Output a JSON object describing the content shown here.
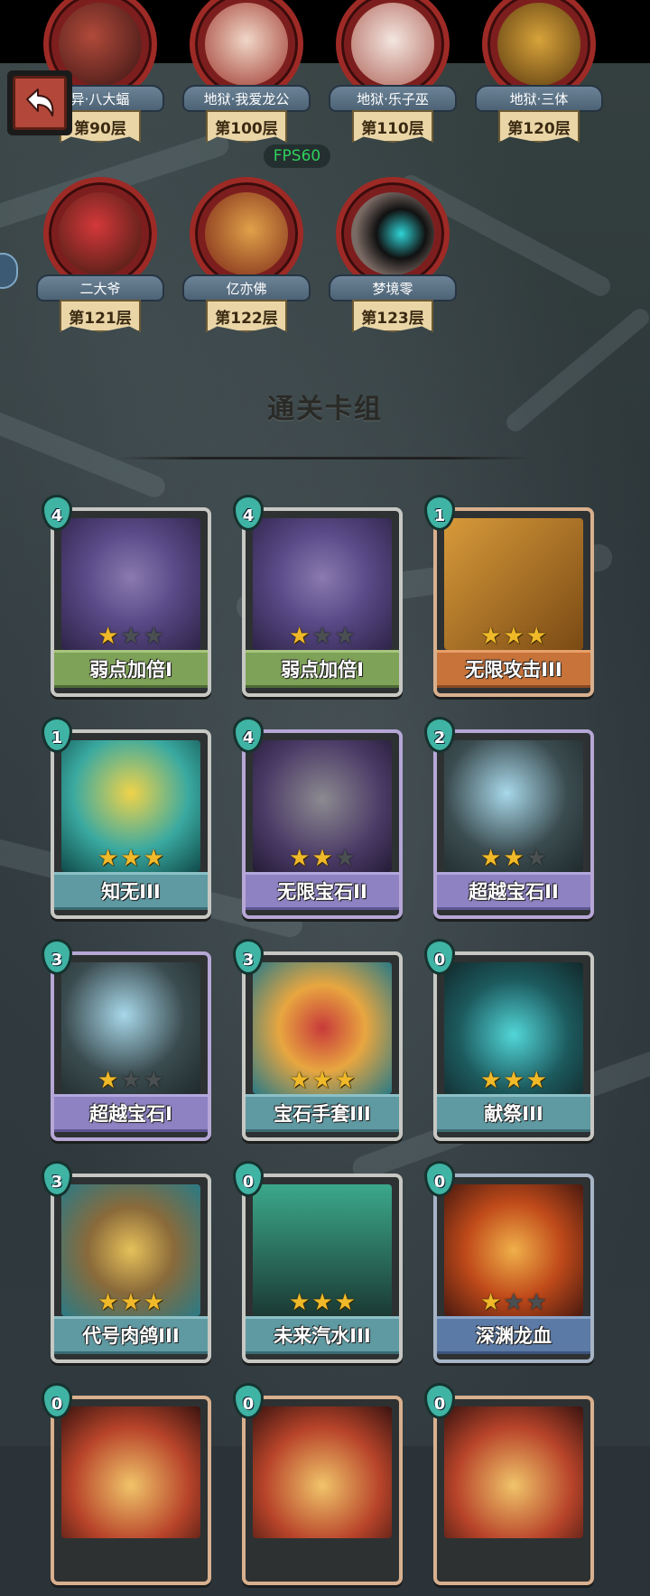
{
  "ui": {
    "back_icon": "back-arrow-icon",
    "fps_label": "FPS60",
    "section_title": "通关卡组"
  },
  "bosses_row1": [
    {
      "name": "异·八大蝠",
      "floor": "第90层"
    },
    {
      "name": "地狱·我爱龙公",
      "floor": "第100层"
    },
    {
      "name": "地狱·乐子巫",
      "floor": "第110层"
    },
    {
      "name": "地狱·三体",
      "floor": "第120层"
    }
  ],
  "bosses_row2": [
    {
      "name": "二大爷",
      "floor": "第121层"
    },
    {
      "name": "亿亦佛",
      "floor": "第122层"
    },
    {
      "name": "梦境零",
      "floor": "第123层"
    }
  ],
  "cards": [
    {
      "cost": "4",
      "name": "弱点加倍I",
      "stars": 1,
      "rarity": "green"
    },
    {
      "cost": "4",
      "name": "弱点加倍I",
      "stars": 1,
      "rarity": "green"
    },
    {
      "cost": "1",
      "name": "无限攻击III",
      "stars": 3,
      "rarity": "orange"
    },
    {
      "cost": "1",
      "name": "知无III",
      "stars": 3,
      "rarity": "teal"
    },
    {
      "cost": "4",
      "name": "无限宝石II",
      "stars": 2,
      "rarity": "purple"
    },
    {
      "cost": "2",
      "name": "超越宝石II",
      "stars": 2,
      "rarity": "purple"
    },
    {
      "cost": "3",
      "name": "超越宝石I",
      "stars": 1,
      "rarity": "purple"
    },
    {
      "cost": "3",
      "name": "宝石手套III",
      "stars": 3,
      "rarity": "teal"
    },
    {
      "cost": "0",
      "name": "献祭III",
      "stars": 3,
      "rarity": "teal"
    },
    {
      "cost": "3",
      "name": "代号肉鸽III",
      "stars": 3,
      "rarity": "teal"
    },
    {
      "cost": "0",
      "name": "未来汽水III",
      "stars": 3,
      "rarity": "teal"
    },
    {
      "cost": "0",
      "name": "深渊龙血",
      "stars": 1,
      "rarity": "blue"
    },
    {
      "cost": "0",
      "name": "",
      "stars": 0,
      "rarity": "orange"
    },
    {
      "cost": "0",
      "name": "",
      "stars": 0,
      "rarity": "orange"
    },
    {
      "cost": "0",
      "name": "",
      "stars": 0,
      "rarity": "orange"
    }
  ]
}
